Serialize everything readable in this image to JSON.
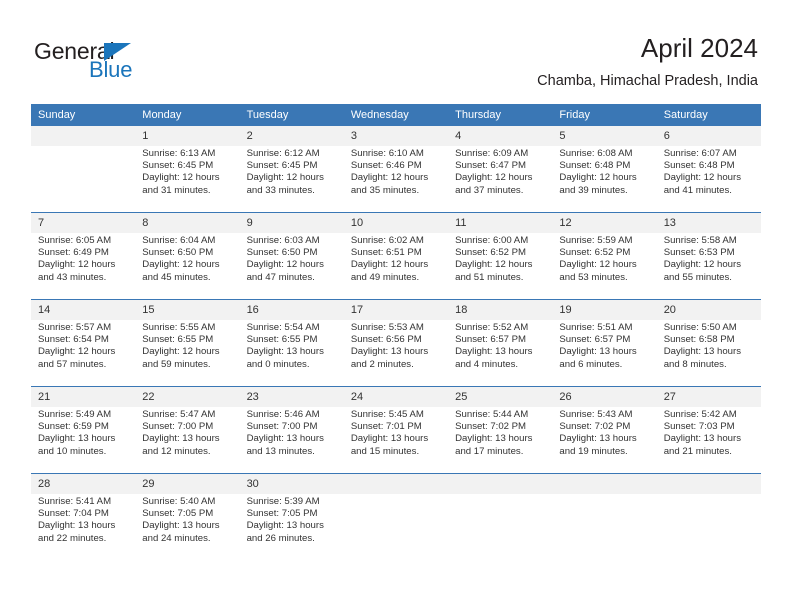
{
  "brand": {
    "name_part1": "General",
    "name_part2": "Blue",
    "triangle_color": "#1b75bb"
  },
  "header": {
    "title": "April 2024",
    "subtitle": "Chamba, Himachal Pradesh, India"
  },
  "theme": {
    "header_bg": "#3a77b5",
    "date_band_bg": "#f2f2f2",
    "text_color": "#333333",
    "separator_color": "#3a77b5"
  },
  "weekdays": [
    "Sunday",
    "Monday",
    "Tuesday",
    "Wednesday",
    "Thursday",
    "Friday",
    "Saturday"
  ],
  "calendar": {
    "month": "April",
    "year": "2024",
    "weeks": [
      [
        {
          "day": "",
          "lines": []
        },
        {
          "day": "1",
          "lines": [
            "Sunrise: 6:13 AM",
            "Sunset: 6:45 PM",
            "Daylight: 12 hours",
            "and 31 minutes."
          ]
        },
        {
          "day": "2",
          "lines": [
            "Sunrise: 6:12 AM",
            "Sunset: 6:45 PM",
            "Daylight: 12 hours",
            "and 33 minutes."
          ]
        },
        {
          "day": "3",
          "lines": [
            "Sunrise: 6:10 AM",
            "Sunset: 6:46 PM",
            "Daylight: 12 hours",
            "and 35 minutes."
          ]
        },
        {
          "day": "4",
          "lines": [
            "Sunrise: 6:09 AM",
            "Sunset: 6:47 PM",
            "Daylight: 12 hours",
            "and 37 minutes."
          ]
        },
        {
          "day": "5",
          "lines": [
            "Sunrise: 6:08 AM",
            "Sunset: 6:48 PM",
            "Daylight: 12 hours",
            "and 39 minutes."
          ]
        },
        {
          "day": "6",
          "lines": [
            "Sunrise: 6:07 AM",
            "Sunset: 6:48 PM",
            "Daylight: 12 hours",
            "and 41 minutes."
          ]
        }
      ],
      [
        {
          "day": "7",
          "lines": [
            "Sunrise: 6:05 AM",
            "Sunset: 6:49 PM",
            "Daylight: 12 hours",
            "and 43 minutes."
          ]
        },
        {
          "day": "8",
          "lines": [
            "Sunrise: 6:04 AM",
            "Sunset: 6:50 PM",
            "Daylight: 12 hours",
            "and 45 minutes."
          ]
        },
        {
          "day": "9",
          "lines": [
            "Sunrise: 6:03 AM",
            "Sunset: 6:50 PM",
            "Daylight: 12 hours",
            "and 47 minutes."
          ]
        },
        {
          "day": "10",
          "lines": [
            "Sunrise: 6:02 AM",
            "Sunset: 6:51 PM",
            "Daylight: 12 hours",
            "and 49 minutes."
          ]
        },
        {
          "day": "11",
          "lines": [
            "Sunrise: 6:00 AM",
            "Sunset: 6:52 PM",
            "Daylight: 12 hours",
            "and 51 minutes."
          ]
        },
        {
          "day": "12",
          "lines": [
            "Sunrise: 5:59 AM",
            "Sunset: 6:52 PM",
            "Daylight: 12 hours",
            "and 53 minutes."
          ]
        },
        {
          "day": "13",
          "lines": [
            "Sunrise: 5:58 AM",
            "Sunset: 6:53 PM",
            "Daylight: 12 hours",
            "and 55 minutes."
          ]
        }
      ],
      [
        {
          "day": "14",
          "lines": [
            "Sunrise: 5:57 AM",
            "Sunset: 6:54 PM",
            "Daylight: 12 hours",
            "and 57 minutes."
          ]
        },
        {
          "day": "15",
          "lines": [
            "Sunrise: 5:55 AM",
            "Sunset: 6:55 PM",
            "Daylight: 12 hours",
            "and 59 minutes."
          ]
        },
        {
          "day": "16",
          "lines": [
            "Sunrise: 5:54 AM",
            "Sunset: 6:55 PM",
            "Daylight: 13 hours",
            "and 0 minutes."
          ]
        },
        {
          "day": "17",
          "lines": [
            "Sunrise: 5:53 AM",
            "Sunset: 6:56 PM",
            "Daylight: 13 hours",
            "and 2 minutes."
          ]
        },
        {
          "day": "18",
          "lines": [
            "Sunrise: 5:52 AM",
            "Sunset: 6:57 PM",
            "Daylight: 13 hours",
            "and 4 minutes."
          ]
        },
        {
          "day": "19",
          "lines": [
            "Sunrise: 5:51 AM",
            "Sunset: 6:57 PM",
            "Daylight: 13 hours",
            "and 6 minutes."
          ]
        },
        {
          "day": "20",
          "lines": [
            "Sunrise: 5:50 AM",
            "Sunset: 6:58 PM",
            "Daylight: 13 hours",
            "and 8 minutes."
          ]
        }
      ],
      [
        {
          "day": "21",
          "lines": [
            "Sunrise: 5:49 AM",
            "Sunset: 6:59 PM",
            "Daylight: 13 hours",
            "and 10 minutes."
          ]
        },
        {
          "day": "22",
          "lines": [
            "Sunrise: 5:47 AM",
            "Sunset: 7:00 PM",
            "Daylight: 13 hours",
            "and 12 minutes."
          ]
        },
        {
          "day": "23",
          "lines": [
            "Sunrise: 5:46 AM",
            "Sunset: 7:00 PM",
            "Daylight: 13 hours",
            "and 13 minutes."
          ]
        },
        {
          "day": "24",
          "lines": [
            "Sunrise: 5:45 AM",
            "Sunset: 7:01 PM",
            "Daylight: 13 hours",
            "and 15 minutes."
          ]
        },
        {
          "day": "25",
          "lines": [
            "Sunrise: 5:44 AM",
            "Sunset: 7:02 PM",
            "Daylight: 13 hours",
            "and 17 minutes."
          ]
        },
        {
          "day": "26",
          "lines": [
            "Sunrise: 5:43 AM",
            "Sunset: 7:02 PM",
            "Daylight: 13 hours",
            "and 19 minutes."
          ]
        },
        {
          "day": "27",
          "lines": [
            "Sunrise: 5:42 AM",
            "Sunset: 7:03 PM",
            "Daylight: 13 hours",
            "and 21 minutes."
          ]
        }
      ],
      [
        {
          "day": "28",
          "lines": [
            "Sunrise: 5:41 AM",
            "Sunset: 7:04 PM",
            "Daylight: 13 hours",
            "and 22 minutes."
          ]
        },
        {
          "day": "29",
          "lines": [
            "Sunrise: 5:40 AM",
            "Sunset: 7:05 PM",
            "Daylight: 13 hours",
            "and 24 minutes."
          ]
        },
        {
          "day": "30",
          "lines": [
            "Sunrise: 5:39 AM",
            "Sunset: 7:05 PM",
            "Daylight: 13 hours",
            "and 26 minutes."
          ]
        },
        {
          "day": "",
          "lines": []
        },
        {
          "day": "",
          "lines": []
        },
        {
          "day": "",
          "lines": []
        },
        {
          "day": "",
          "lines": []
        }
      ]
    ]
  }
}
